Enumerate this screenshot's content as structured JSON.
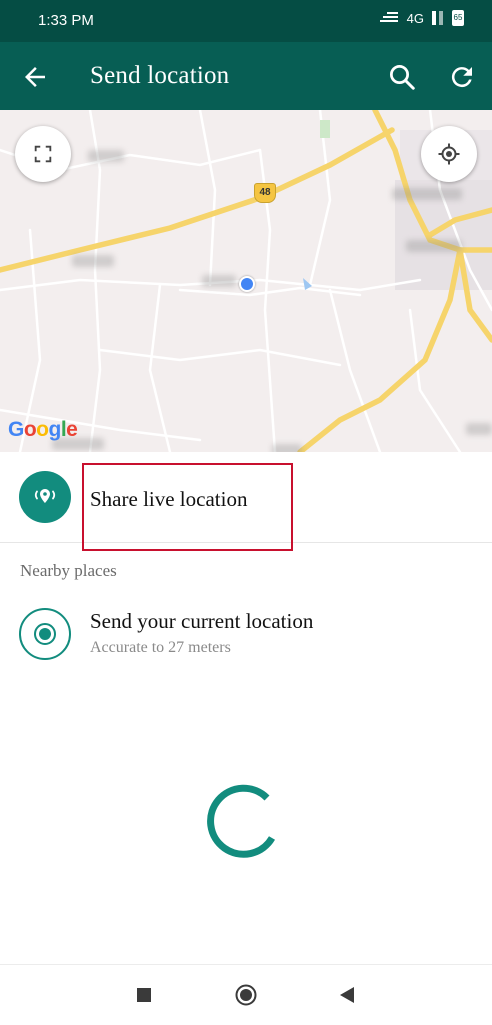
{
  "status_bar": {
    "time": "1:33 PM",
    "network": "4G",
    "battery": "65"
  },
  "app_bar": {
    "title": "Send location"
  },
  "map": {
    "highway_number": "48",
    "google_logo": "Google"
  },
  "share_live": {
    "label": "Share live location"
  },
  "nearby": {
    "header": "Nearby places"
  },
  "current_location": {
    "title": "Send your current location",
    "subtitle": "Accurate to 27 meters"
  },
  "colors": {
    "header_dark": "#054d44",
    "header": "#075e54",
    "accent": "#128c7e",
    "highlight": "#c8102e",
    "road": "#f6d46b"
  }
}
